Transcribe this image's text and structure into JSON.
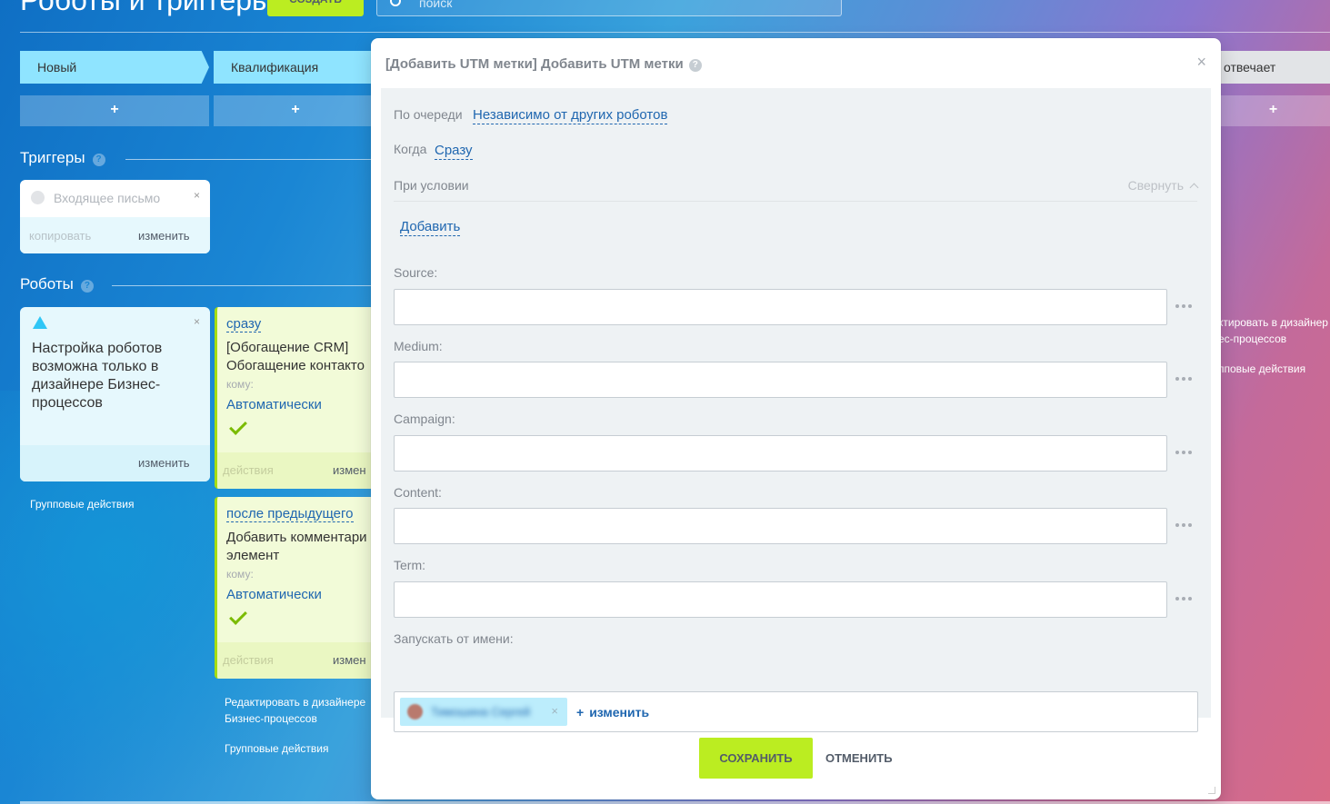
{
  "header": {
    "title": "Роботы и триггеры",
    "create_label": "СОЗДАТЬ",
    "search_placeholder": "поиск"
  },
  "stages": [
    {
      "label": "Новый"
    },
    {
      "label": "Квалификация"
    },
    {
      "label": "отвечает"
    }
  ],
  "stage_add_label": "+",
  "triggers": {
    "section_label": "Триггеры",
    "help": "?",
    "card": {
      "title": "Входящее письмо",
      "close": "×",
      "copy_label": "копировать",
      "edit_label": "изменить"
    }
  },
  "robots": {
    "section_label": "Роботы",
    "help": "?",
    "warning": {
      "text": "Настройка роботов возможна только в дизайнере Бизнес-процессов",
      "close": "×",
      "edit_label": "изменить"
    },
    "group_actions": "Групповые действия",
    "cards": [
      {
        "when": "сразу",
        "name": "[Обогащение CRM] Обогащение контакто",
        "to": "кому:",
        "mode": "Автоматически",
        "actions": "действия",
        "edit": "измен"
      },
      {
        "when": "после предыдущего",
        "name": "Добавить комментари элемент",
        "to": "кому:",
        "mode": "Автоматически",
        "actions": "действия",
        "edit": "измен"
      }
    ],
    "designer_link": "Редактировать в дизайнере Бизнес-процессов",
    "group_actions_2": "Групповые действия",
    "right_designer_link": "ктировать в дизайнер ес-процессов",
    "right_group_actions": "пповые действия"
  },
  "modal": {
    "title": "[Добавить UTM метки] Добавить UTM метки",
    "help": "?",
    "close": "×",
    "order_label": "По очереди",
    "order_value": "Независимо от других роботов",
    "when_label": "Когда",
    "when_value": "Сразу",
    "condition_label": "При условии",
    "collapse_label": "Свернуть",
    "add_condition_label": "Добавить",
    "fields": [
      {
        "label": "Source:",
        "value": ""
      },
      {
        "label": "Medium:",
        "value": ""
      },
      {
        "label": "Campaign:",
        "value": ""
      },
      {
        "label": "Content:",
        "value": ""
      },
      {
        "label": "Term:",
        "value": ""
      }
    ],
    "run_as_label": "Запускать от имени:",
    "run_as_user": "Тимошина Сергей",
    "change_label": "изменить",
    "save_label": "СОХРАНИТЬ",
    "cancel_label": "ОТМЕНИТЬ"
  }
}
